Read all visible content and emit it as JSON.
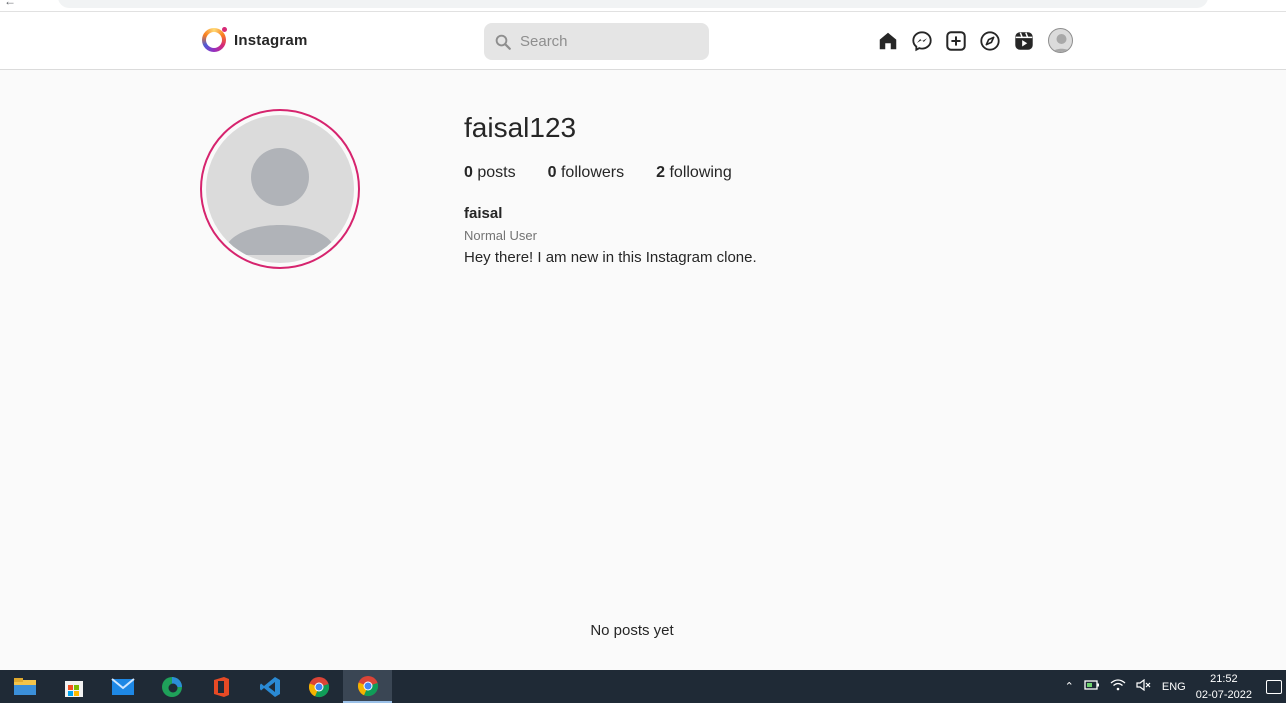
{
  "navbar": {
    "logo_text": "Instagram",
    "search_placeholder": "Search",
    "icons": [
      "home-icon",
      "messenger-icon",
      "add-post-icon",
      "explore-icon",
      "reels-icon",
      "profile-avatar"
    ]
  },
  "profile": {
    "username": "faisal123",
    "posts_count": "0",
    "posts_label": "posts",
    "followers_count": "0",
    "followers_label": "followers",
    "following_count": "2",
    "following_label": "following",
    "full_name": "faisal",
    "user_type": "Normal User",
    "bio": "Hey there! I am new in this Instagram clone.",
    "no_posts_text": "No posts yet"
  },
  "colors": {
    "avatar_ring": "#d6246e",
    "background": "#fafafa",
    "taskbar": "#1f2a36"
  },
  "taskbar": {
    "apps": [
      "file-explorer",
      "microsoft-store",
      "mail",
      "edge",
      "office",
      "vscode",
      "chrome",
      "chrome-active"
    ],
    "tray": {
      "language": "ENG",
      "time": "21:52",
      "date": "02-07-2022"
    }
  }
}
